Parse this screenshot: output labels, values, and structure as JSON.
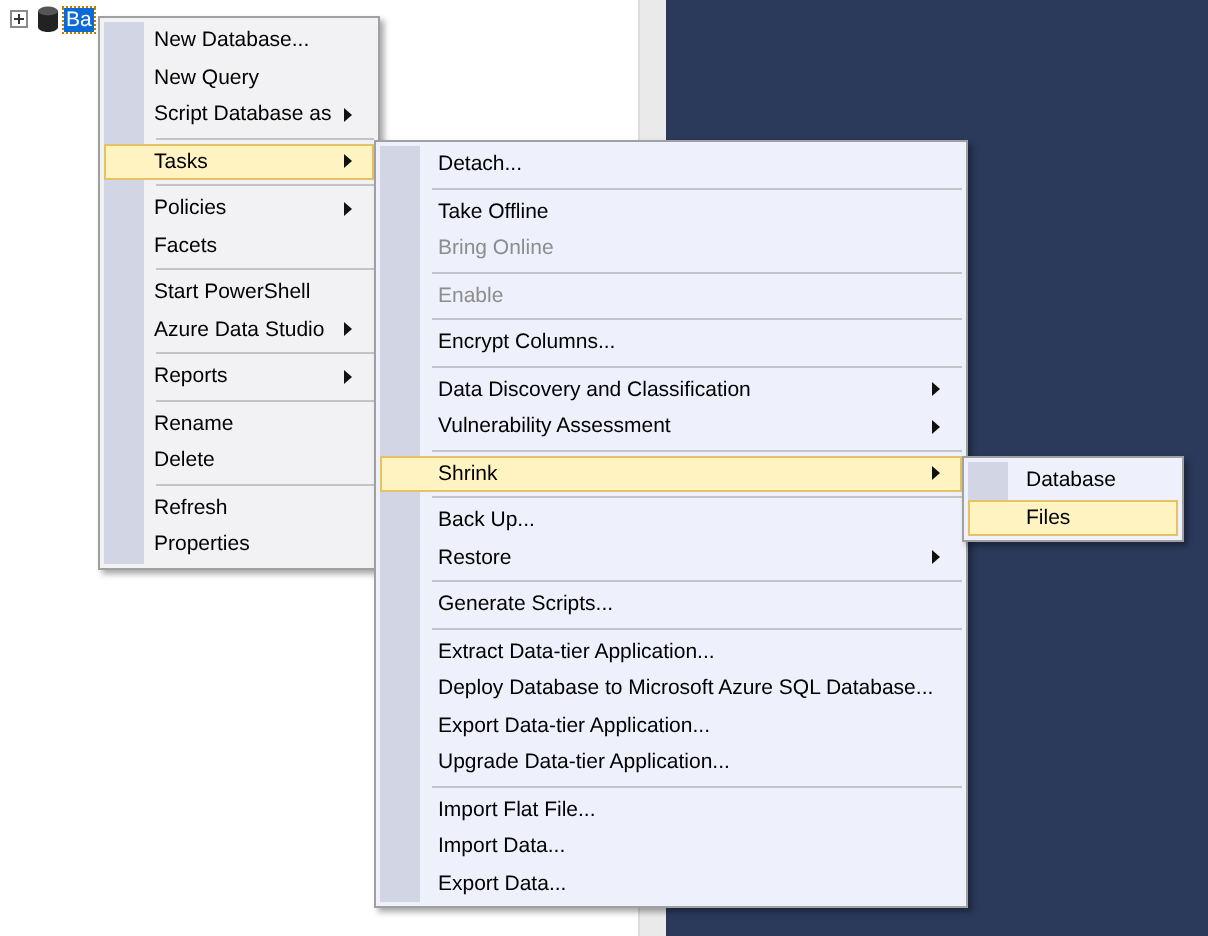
{
  "tree": {
    "node": {
      "label": "Ba",
      "expanded": false,
      "selected": true
    }
  },
  "menus": [
    {
      "items": [
        {
          "kind": "item",
          "label": "New Database...",
          "submenu": false,
          "selected": false,
          "disabled": false
        },
        {
          "kind": "item",
          "label": "New Query",
          "submenu": false,
          "selected": false,
          "disabled": false
        },
        {
          "kind": "item",
          "label": "Script Database as",
          "submenu": true,
          "selected": false,
          "disabled": false
        },
        {
          "kind": "separator"
        },
        {
          "kind": "item",
          "label": "Tasks",
          "submenu": true,
          "selected": true,
          "disabled": false
        },
        {
          "kind": "separator"
        },
        {
          "kind": "item",
          "label": "Policies",
          "submenu": true,
          "selected": false,
          "disabled": false
        },
        {
          "kind": "item",
          "label": "Facets",
          "submenu": false,
          "selected": false,
          "disabled": false
        },
        {
          "kind": "separator"
        },
        {
          "kind": "item",
          "label": "Start PowerShell",
          "submenu": false,
          "selected": false,
          "disabled": false
        },
        {
          "kind": "item",
          "label": "Azure Data Studio",
          "submenu": true,
          "selected": false,
          "disabled": false
        },
        {
          "kind": "separator"
        },
        {
          "kind": "item",
          "label": "Reports",
          "submenu": true,
          "selected": false,
          "disabled": false
        },
        {
          "kind": "separator"
        },
        {
          "kind": "item",
          "label": "Rename",
          "submenu": false,
          "selected": false,
          "disabled": false
        },
        {
          "kind": "item",
          "label": "Delete",
          "submenu": false,
          "selected": false,
          "disabled": false
        },
        {
          "kind": "separator"
        },
        {
          "kind": "item",
          "label": "Refresh",
          "submenu": false,
          "selected": false,
          "disabled": false
        },
        {
          "kind": "item",
          "label": "Properties",
          "submenu": false,
          "selected": false,
          "disabled": false
        }
      ]
    },
    {
      "items": [
        {
          "kind": "item",
          "label": "Detach...",
          "submenu": false,
          "selected": false,
          "disabled": false
        },
        {
          "kind": "separator"
        },
        {
          "kind": "item",
          "label": "Take Offline",
          "submenu": false,
          "selected": false,
          "disabled": false
        },
        {
          "kind": "item",
          "label": "Bring Online",
          "submenu": false,
          "selected": false,
          "disabled": true
        },
        {
          "kind": "separator"
        },
        {
          "kind": "item",
          "label": "Enable",
          "submenu": false,
          "selected": false,
          "disabled": true
        },
        {
          "kind": "separator"
        },
        {
          "kind": "item",
          "label": "Encrypt Columns...",
          "submenu": false,
          "selected": false,
          "disabled": false
        },
        {
          "kind": "separator"
        },
        {
          "kind": "item",
          "label": "Data Discovery and Classification",
          "submenu": true,
          "selected": false,
          "disabled": false
        },
        {
          "kind": "item",
          "label": "Vulnerability Assessment",
          "submenu": true,
          "selected": false,
          "disabled": false
        },
        {
          "kind": "separator"
        },
        {
          "kind": "item",
          "label": "Shrink",
          "submenu": true,
          "selected": true,
          "disabled": false
        },
        {
          "kind": "separator"
        },
        {
          "kind": "item",
          "label": "Back Up...",
          "submenu": false,
          "selected": false,
          "disabled": false
        },
        {
          "kind": "item",
          "label": "Restore",
          "submenu": true,
          "selected": false,
          "disabled": false
        },
        {
          "kind": "separator"
        },
        {
          "kind": "item",
          "label": "Generate Scripts...",
          "submenu": false,
          "selected": false,
          "disabled": false
        },
        {
          "kind": "separator"
        },
        {
          "kind": "item",
          "label": "Extract Data-tier Application...",
          "submenu": false,
          "selected": false,
          "disabled": false
        },
        {
          "kind": "item",
          "label": "Deploy Database to Microsoft Azure SQL Database...",
          "submenu": false,
          "selected": false,
          "disabled": false
        },
        {
          "kind": "item",
          "label": "Export Data-tier Application...",
          "submenu": false,
          "selected": false,
          "disabled": false
        },
        {
          "kind": "item",
          "label": "Upgrade Data-tier Application...",
          "submenu": false,
          "selected": false,
          "disabled": false
        },
        {
          "kind": "separator"
        },
        {
          "kind": "item",
          "label": "Import Flat File...",
          "submenu": false,
          "selected": false,
          "disabled": false
        },
        {
          "kind": "item",
          "label": "Import Data...",
          "submenu": false,
          "selected": false,
          "disabled": false
        },
        {
          "kind": "item",
          "label": "Export Data...",
          "submenu": false,
          "selected": false,
          "disabled": false
        }
      ]
    },
    {
      "items": [
        {
          "kind": "item",
          "label": "Database",
          "submenu": false,
          "selected": false,
          "disabled": false
        },
        {
          "kind": "item",
          "label": "Files",
          "submenu": false,
          "selected": true,
          "disabled": false
        }
      ]
    }
  ]
}
